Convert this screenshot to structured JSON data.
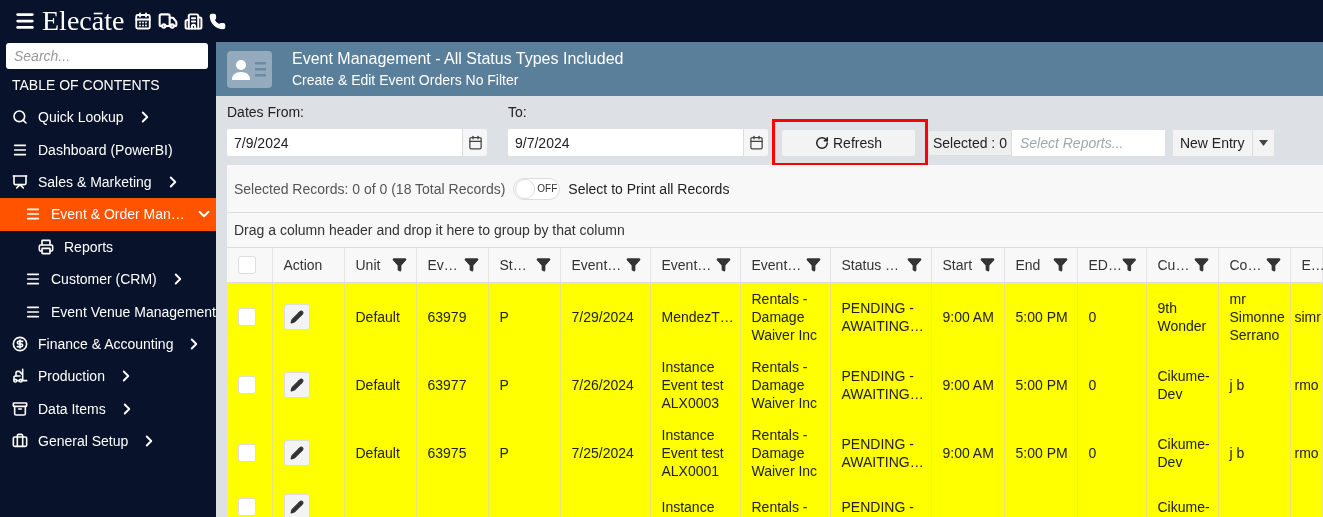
{
  "app": {
    "logo": "Elecāte"
  },
  "sidebar": {
    "search": {
      "placeholder": "Search..."
    },
    "heading": "TABLE OF CONTENTS",
    "items": [
      {
        "label": "Quick Lookup",
        "selected": false,
        "expanded": false
      },
      {
        "label": "Dashboard (PowerBI)",
        "selected": false
      },
      {
        "label": "Sales & Marketing",
        "selected": false,
        "expanded": false,
        "children": [
          {
            "label": "Event & Order Man…",
            "selected": true,
            "expanded": true,
            "children": [
              {
                "label": "Reports",
                "selected": false
              }
            ]
          },
          {
            "label": "Customer (CRM)",
            "selected": false,
            "expanded": false
          },
          {
            "label": "Event Venue Management",
            "selected": false
          }
        ]
      },
      {
        "label": "Finance & Accounting",
        "selected": false,
        "expanded": false
      },
      {
        "label": "Production",
        "selected": false,
        "expanded": false
      },
      {
        "label": "Data Items",
        "selected": false,
        "expanded": false
      },
      {
        "label": "General Setup",
        "selected": false,
        "expanded": false
      }
    ]
  },
  "header": {
    "title": "Event Management - All Status Types Included",
    "subtitle": "Create & Edit Event Orders No Filter"
  },
  "filters": {
    "from": {
      "label": "Dates From:",
      "value": "7/9/2024"
    },
    "to": {
      "label": "To:",
      "value": "9/7/2024"
    },
    "refresh": {
      "label": "Refresh",
      "highlighted": true
    },
    "selected_badge": "Selected : 0",
    "reports": {
      "placeholder": "Select Reports..."
    },
    "new_entry": {
      "label": "New Entry"
    }
  },
  "records_bar": {
    "summary": "Selected Records: 0 of 0 (18 Total Records)",
    "toggle": {
      "on": false,
      "label": "OFF"
    },
    "toggle_caption": "Select to Print all Records"
  },
  "group_hint": "Drag a column header and drop it here to group by that column",
  "table": {
    "select_all_checked": false,
    "action_label": "Action",
    "columns": [
      {
        "kind": "data",
        "label": "Unit",
        "filter": true
      },
      {
        "kind": "data",
        "label": "Ev…",
        "filter": true
      },
      {
        "kind": "data",
        "label": "St…",
        "filter": true
      },
      {
        "kind": "data",
        "label": "Event…",
        "filter": true
      },
      {
        "kind": "data",
        "label": "Event…",
        "filter": true
      },
      {
        "kind": "data",
        "label": "Event…",
        "filter": true
      },
      {
        "kind": "data",
        "label": "Status …",
        "filter": true
      },
      {
        "kind": "data",
        "label": "Start",
        "filter": true
      },
      {
        "kind": "data",
        "label": "End",
        "filter": true
      },
      {
        "kind": "data",
        "label": "ED…",
        "filter": true
      },
      {
        "kind": "data",
        "label": "Cu…",
        "filter": true
      },
      {
        "kind": "data",
        "label": "Co…",
        "filter": true
      },
      {
        "kind": "data",
        "label": "E…",
        "filter": false
      }
    ],
    "rows": [
      {
        "checked": false,
        "cells": [
          "Default",
          "63979",
          "P",
          "7/29/2024",
          "MendezT…",
          "Rentals - Damage Waiver Inc",
          "PENDING - AWAITING…",
          "9:00 AM",
          "5:00 PM",
          "0",
          "9th Wonder",
          "mr Simonne Serrano",
          "simr"
        ]
      },
      {
        "checked": false,
        "cells": [
          "Default",
          "63977",
          "P",
          "7/26/2024",
          "Instance Event test ALX0003",
          "Rentals - Damage Waiver Inc",
          "PENDING - AWAITING…",
          "9:00 AM",
          "5:00 PM",
          "0",
          "Cikume-Dev",
          "j b",
          "rmo"
        ]
      },
      {
        "checked": false,
        "cells": [
          "Default",
          "63975",
          "P",
          "7/25/2024",
          "Instance Event test ALX0001",
          "Rentals - Damage Waiver Inc",
          "PENDING - AWAITING…",
          "9:00 AM",
          "5:00 PM",
          "0",
          "Cikume-Dev",
          "j b",
          "rmo"
        ]
      },
      {
        "checked": false,
        "cells": [
          null,
          null,
          null,
          null,
          "Instance",
          "Rentals -",
          "PENDING -",
          null,
          null,
          null,
          "Cikume-",
          null,
          null
        ]
      }
    ]
  }
}
